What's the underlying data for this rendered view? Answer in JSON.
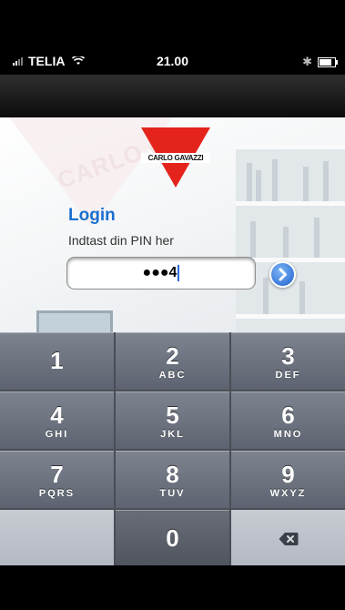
{
  "status_bar": {
    "carrier": "TELIA",
    "time": "21.00",
    "battery_level": 0.8
  },
  "brand": {
    "logo_text": "CARLO GAVAZZI",
    "wall_watermark": "CARLO GA",
    "colors": {
      "logo_red": "#e4241c",
      "title_blue": "#1a6fd0"
    }
  },
  "login": {
    "title": "Login",
    "subtitle": "Indtast din PIN her",
    "pin_masked": "●●●4",
    "go_icon": "chevron-right-icon"
  },
  "keypad": {
    "keys": [
      {
        "digit": "1",
        "letters": ""
      },
      {
        "digit": "2",
        "letters": "ABC"
      },
      {
        "digit": "3",
        "letters": "DEF"
      },
      {
        "digit": "4",
        "letters": "GHI"
      },
      {
        "digit": "5",
        "letters": "JKL"
      },
      {
        "digit": "6",
        "letters": "MNO"
      },
      {
        "digit": "7",
        "letters": "PQRS"
      },
      {
        "digit": "8",
        "letters": "TUV"
      },
      {
        "digit": "9",
        "letters": "WXYZ"
      },
      {
        "digit": "0",
        "letters": ""
      }
    ],
    "delete_icon": "backspace-icon"
  }
}
